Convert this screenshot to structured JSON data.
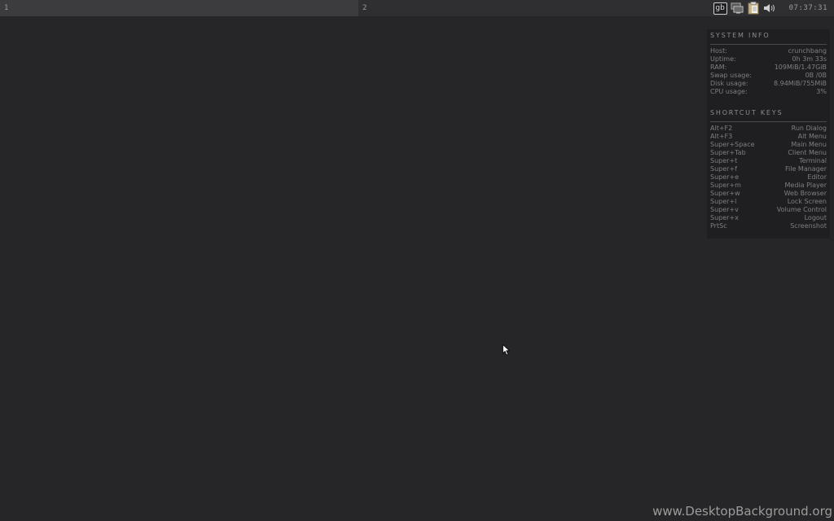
{
  "taskbar": {
    "desktops": [
      {
        "label": "1"
      },
      {
        "label": "2"
      }
    ],
    "tray": {
      "keyboard_layout": "gb",
      "icons": [
        "network-icon",
        "clipboard-icon",
        "volume-icon"
      ],
      "clock": "07:37:31"
    }
  },
  "conky": {
    "system_info": {
      "title": "SYSTEM INFO",
      "rows": [
        {
          "label": "Host:",
          "value": "crunchbang"
        },
        {
          "label": "Uptime:",
          "value": "0h 3m 33s"
        },
        {
          "label": "RAM:",
          "value": "109MiB/1.47GiB"
        },
        {
          "label": "Swap usage:",
          "value": "0B /0B"
        },
        {
          "label": "Disk usage:",
          "value": "8.94MiB/755MiB"
        },
        {
          "label": "CPU usage:",
          "value": "3%"
        }
      ]
    },
    "shortcut_keys": {
      "title": "SHORTCUT KEYS",
      "rows": [
        {
          "label": "Alt+F2",
          "value": "Run Dialog"
        },
        {
          "label": "Alt+F3",
          "value": "Alt Menu"
        },
        {
          "label": "Super+Space",
          "value": "Main Menu"
        },
        {
          "label": "Super+Tab",
          "value": "Client Menu"
        },
        {
          "label": "Super+t",
          "value": "Terminal"
        },
        {
          "label": "Super+f",
          "value": "File Manager"
        },
        {
          "label": "Super+e",
          "value": "Editor"
        },
        {
          "label": "Super+m",
          "value": "Media Player"
        },
        {
          "label": "Super+w",
          "value": "Web Browser"
        },
        {
          "label": "Super+l",
          "value": "Lock Screen"
        },
        {
          "label": "Super+v",
          "value": "Volume Control"
        },
        {
          "label": "Super+x",
          "value": "Logout"
        },
        {
          "label": "PrtSc",
          "value": "Screenshot"
        }
      ]
    }
  },
  "watermark": "www.DesktopBackground.org"
}
